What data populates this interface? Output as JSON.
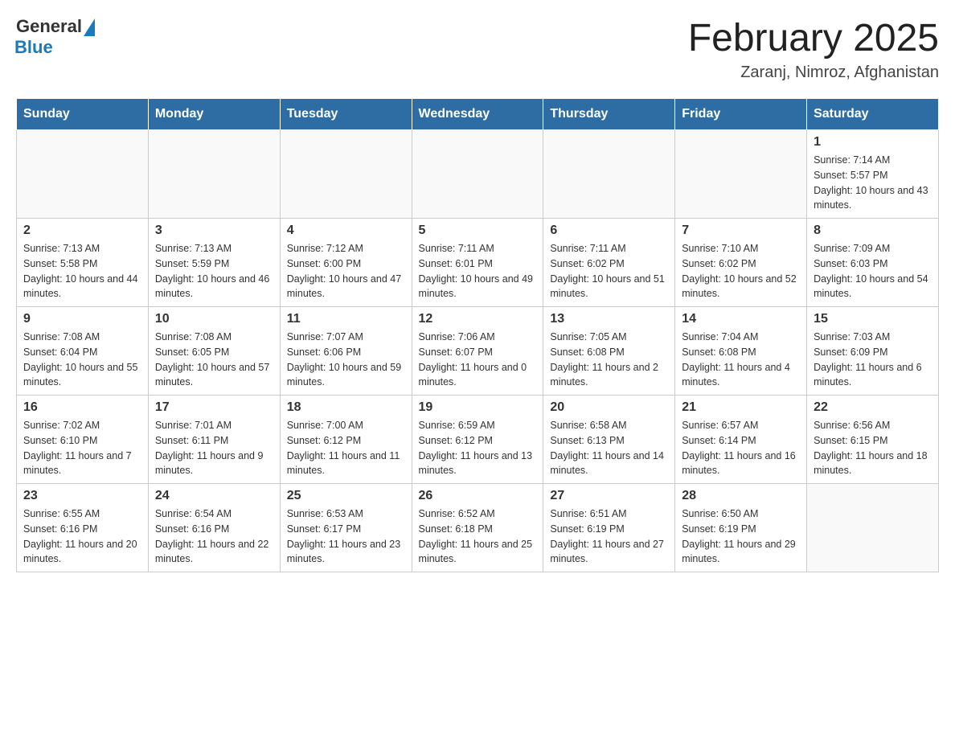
{
  "header": {
    "logo_general": "General",
    "logo_blue": "Blue",
    "month_title": "February 2025",
    "location": "Zaranj, Nimroz, Afghanistan"
  },
  "days_of_week": [
    "Sunday",
    "Monday",
    "Tuesday",
    "Wednesday",
    "Thursday",
    "Friday",
    "Saturday"
  ],
  "weeks": [
    {
      "days": [
        {
          "date": "",
          "info": ""
        },
        {
          "date": "",
          "info": ""
        },
        {
          "date": "",
          "info": ""
        },
        {
          "date": "",
          "info": ""
        },
        {
          "date": "",
          "info": ""
        },
        {
          "date": "",
          "info": ""
        },
        {
          "date": "1",
          "sunrise": "Sunrise: 7:14 AM",
          "sunset": "Sunset: 5:57 PM",
          "daylight": "Daylight: 10 hours and 43 minutes."
        }
      ]
    },
    {
      "days": [
        {
          "date": "2",
          "sunrise": "Sunrise: 7:13 AM",
          "sunset": "Sunset: 5:58 PM",
          "daylight": "Daylight: 10 hours and 44 minutes."
        },
        {
          "date": "3",
          "sunrise": "Sunrise: 7:13 AM",
          "sunset": "Sunset: 5:59 PM",
          "daylight": "Daylight: 10 hours and 46 minutes."
        },
        {
          "date": "4",
          "sunrise": "Sunrise: 7:12 AM",
          "sunset": "Sunset: 6:00 PM",
          "daylight": "Daylight: 10 hours and 47 minutes."
        },
        {
          "date": "5",
          "sunrise": "Sunrise: 7:11 AM",
          "sunset": "Sunset: 6:01 PM",
          "daylight": "Daylight: 10 hours and 49 minutes."
        },
        {
          "date": "6",
          "sunrise": "Sunrise: 7:11 AM",
          "sunset": "Sunset: 6:02 PM",
          "daylight": "Daylight: 10 hours and 51 minutes."
        },
        {
          "date": "7",
          "sunrise": "Sunrise: 7:10 AM",
          "sunset": "Sunset: 6:02 PM",
          "daylight": "Daylight: 10 hours and 52 minutes."
        },
        {
          "date": "8",
          "sunrise": "Sunrise: 7:09 AM",
          "sunset": "Sunset: 6:03 PM",
          "daylight": "Daylight: 10 hours and 54 minutes."
        }
      ]
    },
    {
      "days": [
        {
          "date": "9",
          "sunrise": "Sunrise: 7:08 AM",
          "sunset": "Sunset: 6:04 PM",
          "daylight": "Daylight: 10 hours and 55 minutes."
        },
        {
          "date": "10",
          "sunrise": "Sunrise: 7:08 AM",
          "sunset": "Sunset: 6:05 PM",
          "daylight": "Daylight: 10 hours and 57 minutes."
        },
        {
          "date": "11",
          "sunrise": "Sunrise: 7:07 AM",
          "sunset": "Sunset: 6:06 PM",
          "daylight": "Daylight: 10 hours and 59 minutes."
        },
        {
          "date": "12",
          "sunrise": "Sunrise: 7:06 AM",
          "sunset": "Sunset: 6:07 PM",
          "daylight": "Daylight: 11 hours and 0 minutes."
        },
        {
          "date": "13",
          "sunrise": "Sunrise: 7:05 AM",
          "sunset": "Sunset: 6:08 PM",
          "daylight": "Daylight: 11 hours and 2 minutes."
        },
        {
          "date": "14",
          "sunrise": "Sunrise: 7:04 AM",
          "sunset": "Sunset: 6:08 PM",
          "daylight": "Daylight: 11 hours and 4 minutes."
        },
        {
          "date": "15",
          "sunrise": "Sunrise: 7:03 AM",
          "sunset": "Sunset: 6:09 PM",
          "daylight": "Daylight: 11 hours and 6 minutes."
        }
      ]
    },
    {
      "days": [
        {
          "date": "16",
          "sunrise": "Sunrise: 7:02 AM",
          "sunset": "Sunset: 6:10 PM",
          "daylight": "Daylight: 11 hours and 7 minutes."
        },
        {
          "date": "17",
          "sunrise": "Sunrise: 7:01 AM",
          "sunset": "Sunset: 6:11 PM",
          "daylight": "Daylight: 11 hours and 9 minutes."
        },
        {
          "date": "18",
          "sunrise": "Sunrise: 7:00 AM",
          "sunset": "Sunset: 6:12 PM",
          "daylight": "Daylight: 11 hours and 11 minutes."
        },
        {
          "date": "19",
          "sunrise": "Sunrise: 6:59 AM",
          "sunset": "Sunset: 6:12 PM",
          "daylight": "Daylight: 11 hours and 13 minutes."
        },
        {
          "date": "20",
          "sunrise": "Sunrise: 6:58 AM",
          "sunset": "Sunset: 6:13 PM",
          "daylight": "Daylight: 11 hours and 14 minutes."
        },
        {
          "date": "21",
          "sunrise": "Sunrise: 6:57 AM",
          "sunset": "Sunset: 6:14 PM",
          "daylight": "Daylight: 11 hours and 16 minutes."
        },
        {
          "date": "22",
          "sunrise": "Sunrise: 6:56 AM",
          "sunset": "Sunset: 6:15 PM",
          "daylight": "Daylight: 11 hours and 18 minutes."
        }
      ]
    },
    {
      "days": [
        {
          "date": "23",
          "sunrise": "Sunrise: 6:55 AM",
          "sunset": "Sunset: 6:16 PM",
          "daylight": "Daylight: 11 hours and 20 minutes."
        },
        {
          "date": "24",
          "sunrise": "Sunrise: 6:54 AM",
          "sunset": "Sunset: 6:16 PM",
          "daylight": "Daylight: 11 hours and 22 minutes."
        },
        {
          "date": "25",
          "sunrise": "Sunrise: 6:53 AM",
          "sunset": "Sunset: 6:17 PM",
          "daylight": "Daylight: 11 hours and 23 minutes."
        },
        {
          "date": "26",
          "sunrise": "Sunrise: 6:52 AM",
          "sunset": "Sunset: 6:18 PM",
          "daylight": "Daylight: 11 hours and 25 minutes."
        },
        {
          "date": "27",
          "sunrise": "Sunrise: 6:51 AM",
          "sunset": "Sunset: 6:19 PM",
          "daylight": "Daylight: 11 hours and 27 minutes."
        },
        {
          "date": "28",
          "sunrise": "Sunrise: 6:50 AM",
          "sunset": "Sunset: 6:19 PM",
          "daylight": "Daylight: 11 hours and 29 minutes."
        },
        {
          "date": "",
          "info": ""
        }
      ]
    }
  ]
}
